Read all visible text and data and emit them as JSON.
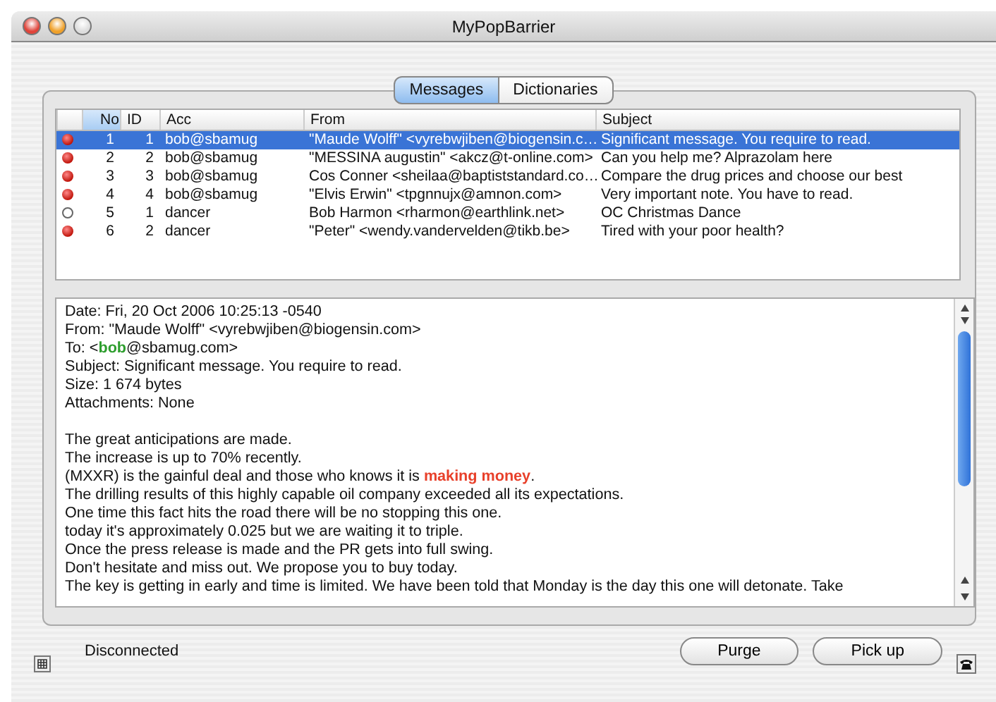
{
  "window": {
    "title": "MyPopBarrier"
  },
  "tabs": [
    {
      "label": "Messages",
      "selected": true
    },
    {
      "label": "Dictionaries",
      "selected": false
    }
  ],
  "table": {
    "columns": [
      "No",
      "ID",
      "Acc",
      "From",
      "Subject"
    ],
    "rows": [
      {
        "unread": true,
        "selected": true,
        "cells": [
          "1",
          "1",
          "bob@sbamug",
          "\"Maude Wolff\" <vyrebwjiben@biogensin.c…",
          "Significant message. You require to read."
        ]
      },
      {
        "unread": true,
        "selected": false,
        "cells": [
          "2",
          "2",
          "bob@sbamug",
          "\"MESSINA augustin\" <akcz@t-online.com>",
          "Can you help me? Alprazolam  here"
        ]
      },
      {
        "unread": true,
        "selected": false,
        "cells": [
          "3",
          "3",
          "bob@sbamug",
          "Cos Conner <sheilaa@baptiststandard.co…",
          "Compare the drug prices and choose our best"
        ]
      },
      {
        "unread": true,
        "selected": false,
        "cells": [
          "4",
          "4",
          "bob@sbamug",
          "\"Elvis Erwin\" <tpgnnujx@amnon.com>",
          "Very important note. You have to read."
        ]
      },
      {
        "unread": false,
        "selected": false,
        "cells": [
          "5",
          "1",
          "dancer",
          "Bob Harmon <rharmon@earthlink.net>",
          "OC Christmas Dance"
        ]
      },
      {
        "unread": true,
        "selected": false,
        "cells": [
          "6",
          "2",
          "dancer",
          "\"Peter\" <wendy.vandervelden@tikb.be>",
          "Tired with your poor health?"
        ]
      }
    ]
  },
  "message": {
    "header": [
      [
        {
          "text": "Date: Fri, 20 Oct 2006 10:25:13 -0540"
        }
      ],
      [
        {
          "text": "From: \"Maude Wolff\" <vyrebwjiben@biogensin.com>"
        }
      ],
      [
        {
          "text": "To: <"
        },
        {
          "text": "bob",
          "color": "#2e9e2e"
        },
        {
          "text": "@sbamug.com>"
        }
      ],
      [
        {
          "text": "Subject: Significant message. You require to read."
        }
      ],
      [
        {
          "text": "Size: 1 674 bytes"
        }
      ],
      [
        {
          "text": "Attachments: None"
        }
      ]
    ],
    "body": [
      [
        {
          "text": "The great anticipations are made."
        }
      ],
      [
        {
          "text": "The increase is up to 70% recently."
        }
      ],
      [
        {
          "text": "(MXXR) is the gainful deal and those who knows it is "
        },
        {
          "text": "making money",
          "color": "#e8402a"
        },
        {
          "text": "."
        }
      ],
      [
        {
          "text": "The drilling results of this highly capable oil company exceeded all its expectations."
        }
      ],
      [
        {
          "text": "One time this fact hits the road there will be no stopping this one."
        }
      ],
      [
        {
          "text": "today it's approximately 0.025 but we are waiting it to triple."
        }
      ],
      [
        {
          "text": "Once the press release is made and the PR gets into full swing."
        }
      ],
      [
        {
          "text": "Don't hesitate and miss out.  We propose you to buy today."
        }
      ],
      [
        {
          "text": "The key is getting in early and time is limited. We have been told that Monday is the day this one will detonate. Take"
        }
      ]
    ]
  },
  "status_bar": {
    "status": "Disconnected",
    "buttons": [
      "Purge",
      "Pick up"
    ]
  }
}
